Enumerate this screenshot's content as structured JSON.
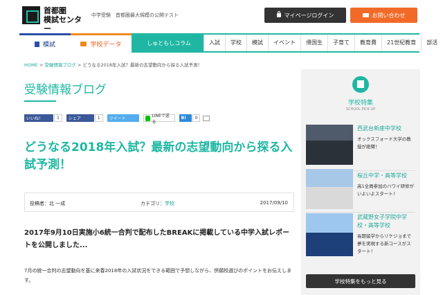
{
  "header": {
    "logo_line1": "首都圏",
    "logo_line2": "模試センター",
    "tagline": "中学受験　首都圏最大規模の公開テスト",
    "login_label": "マイページログイン",
    "contact_label": "お問い合わせ",
    "accent": "#1fb7a3",
    "login_bg": "#333333",
    "contact_bg": "#f26a28"
  },
  "nav": {
    "tab_moshi": "模試",
    "tab_school": "学校データ",
    "column": "しゅともしコラム",
    "cats": [
      "入試",
      "学校",
      "模試",
      "イベント",
      "帰国生",
      "子育て",
      "教育費",
      "21世紀教育",
      "部活"
    ]
  },
  "breadcrumb": {
    "home": "HOME",
    "sep1": ">",
    "blog": "受験情報ブログ",
    "sep2": ">",
    "current": "どうなる2018年入試？最新の志望動向から探る入試予測！"
  },
  "section_title": "受験情報ブログ",
  "share": {
    "fb_like": "いいね！",
    "fb_like_count": "1",
    "fb_share": "シェア",
    "fb_share_count": "1",
    "tweet": "ツイート",
    "line": "LINEで送る",
    "hatena": "B!",
    "hatena_count": "0"
  },
  "article": {
    "title": "どうなる2018年入試？最新の志望動向から探る入試予測！",
    "author_label": "投稿者：北 一成",
    "category_label": "カテゴリ：",
    "category": "学校",
    "date": "2017/09/10",
    "lead": "2017年9月10日実施小6統一合判で配布したBREAKに掲載している中学入試レポートを公開しました...",
    "body": "7月の統一合判の志望動向を基に来春2018年の入試状況をできる範囲で予想しながら、併願校選びのポイントをお伝えします。"
  },
  "sidebar": {
    "title": "学校特集",
    "subtitle": "SCHOOL PICK UP",
    "items": [
      {
        "name": "西武台新座中学校",
        "desc": "オックスフォード大学の教授が絶賛！"
      },
      {
        "name": "桜丘中学・高等学校",
        "desc": "高1全員参加のハワイ研修がいよいよスタート！"
      },
      {
        "name": "武蔵野女子学院中学校・高等学校",
        "desc": "長期留学からリケジョまで 夢を実現する新コースがスタート！"
      }
    ],
    "more_label": "学校特集をもっと見る"
  }
}
